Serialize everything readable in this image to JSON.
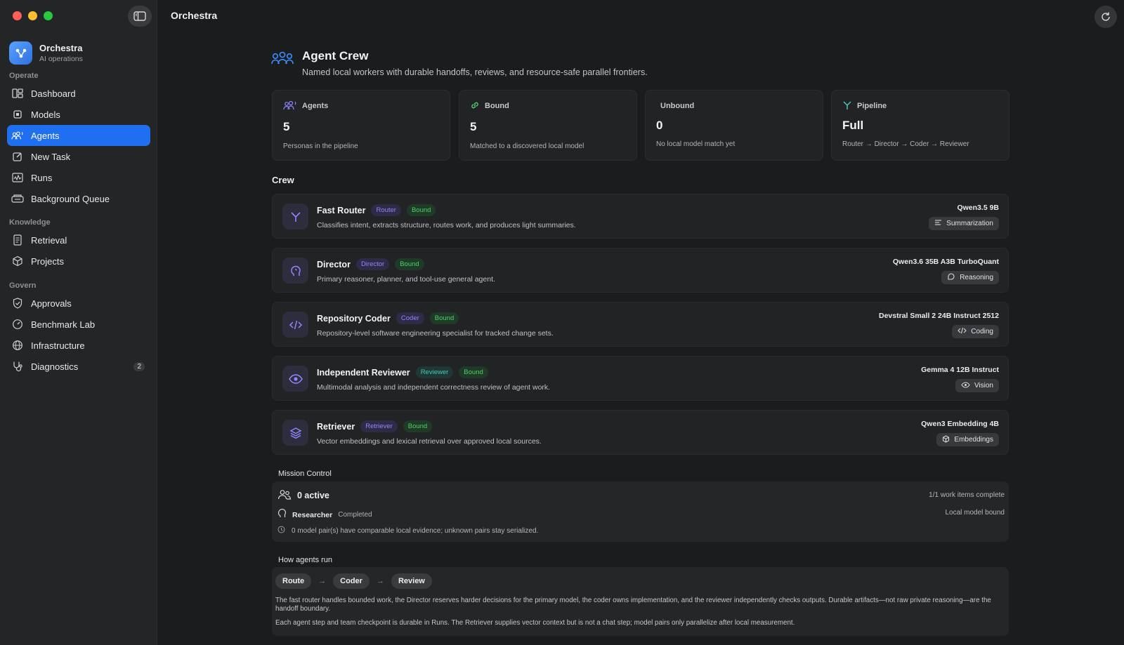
{
  "window": {
    "title": "Orchestra"
  },
  "brand": {
    "name": "Orchestra",
    "subtitle": "AI operations"
  },
  "sidebar": {
    "sections": [
      {
        "label": "Operate"
      },
      {
        "label": "Knowledge"
      },
      {
        "label": "Govern"
      }
    ],
    "items": [
      {
        "label": "Dashboard",
        "icon": "dashboard-icon"
      },
      {
        "label": "Models",
        "icon": "cpu-icon"
      },
      {
        "label": "Agents",
        "icon": "people-icon",
        "active": true
      },
      {
        "label": "New Task",
        "icon": "compose-icon"
      },
      {
        "label": "Runs",
        "icon": "waveform-icon"
      },
      {
        "label": "Background Queue",
        "icon": "queue-icon"
      },
      {
        "label": "Retrieval",
        "icon": "document-icon"
      },
      {
        "label": "Projects",
        "icon": "cube-icon"
      },
      {
        "label": "Approvals",
        "icon": "shield-check-icon"
      },
      {
        "label": "Benchmark Lab",
        "icon": "gauge-icon"
      },
      {
        "label": "Infrastructure",
        "icon": "globe-icon"
      },
      {
        "label": "Diagnostics",
        "icon": "stethoscope-icon",
        "badge": "2"
      }
    ]
  },
  "main": {
    "title": "Agent Crew",
    "subtitle": "Named local workers with durable handoffs, reviews, and resource-safe parallel frontiers.",
    "stats": [
      {
        "label": "Agents",
        "value": "5",
        "note": "Personas in the pipeline"
      },
      {
        "label": "Bound",
        "value": "5",
        "note": "Matched to a discovered local model"
      },
      {
        "label": "Unbound",
        "value": "0",
        "note": "No local model match yet"
      },
      {
        "label": "Pipeline",
        "value": "Full",
        "note": "Router → Director → Coder → Reviewer"
      }
    ],
    "crew_label": "Crew",
    "agents": [
      {
        "name": "Fast Router",
        "role": "Router",
        "status": "Bound",
        "desc": "Classifies intent, extracts structure, routes work, and produces light summaries.",
        "model": "Qwen3.5 9B",
        "capability": "Summarization"
      },
      {
        "name": "Director",
        "role": "Director",
        "status": "Bound",
        "desc": "Primary reasoner, planner, and tool-use general agent.",
        "model": "Qwen3.6 35B A3B TurboQuant",
        "capability": "Reasoning"
      },
      {
        "name": "Repository Coder",
        "role": "Coder",
        "status": "Bound",
        "desc": "Repository-level software engineering specialist for tracked change sets.",
        "model": "Devstral Small 2 24B Instruct 2512",
        "capability": "Coding"
      },
      {
        "name": "Independent Reviewer",
        "role": "Reviewer",
        "status": "Bound",
        "desc": "Multimodal analysis and independent correctness review of agent work.",
        "model": "Gemma 4 12B Instruct",
        "capability": "Vision"
      },
      {
        "name": "Retriever",
        "role": "Retriever",
        "status": "Bound",
        "desc": "Vector embeddings and lexical retrieval over approved local sources.",
        "model": "Qwen3 Embedding 4B",
        "capability": "Embeddings"
      }
    ],
    "mission_control": {
      "label": "Mission Control",
      "active": "0 active",
      "work_items": "1/1 work items complete",
      "role": "Researcher",
      "role_status": "Completed",
      "binding": "Local model bound",
      "note": "0 model pair(s) have comparable local evidence; unknown pairs stay serialized."
    },
    "how": {
      "label": "How agents run",
      "steps": [
        "Route",
        "Coder",
        "Review"
      ],
      "p1": "The fast router handles bounded work, the Director reserves harder decisions for the primary model, the coder owns implementation, and the reviewer independently checks outputs. Durable artifacts—not raw private reasoning—are the handoff boundary.",
      "p2": "Each agent step and team checkpoint is durable in Runs. The Retriever supplies vector context but is not a chat step; model pairs only parallelize after local measurement."
    }
  },
  "colors": {
    "accent": "#1f6ff0",
    "bound": "#4fd16a",
    "role": "#8f87ff",
    "reviewer": "#45c8b8"
  }
}
